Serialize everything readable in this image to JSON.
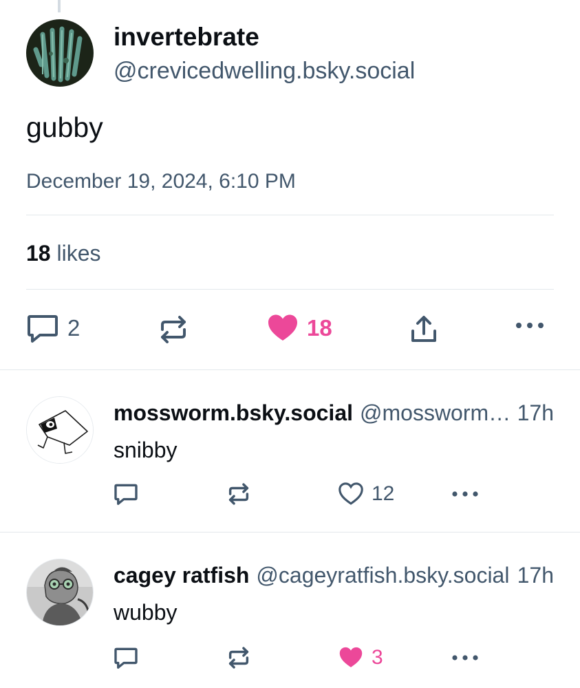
{
  "main_post": {
    "author_name": "invertebrate",
    "author_handle": "@crevicedwelling.bsky.social",
    "text": "gubby",
    "timestamp": "December 19, 2024, 6:10 PM",
    "likes_count": "18",
    "likes_label": "likes",
    "actions": {
      "reply_count": "2",
      "like_count": "18",
      "liked": true
    }
  },
  "replies": [
    {
      "author_name": "mossworm.bsky.social",
      "author_handle": "@mossworm.bsky.social",
      "time": "17h",
      "text": "snibby",
      "like_count": "12",
      "liked": false
    },
    {
      "author_name": "cagey ratfish",
      "author_handle": "@cageyratfish.bsky.social",
      "time": "17h",
      "text": "wubby",
      "like_count": "3",
      "liked": true
    }
  ],
  "icons": {
    "reply": "comment-icon",
    "repost": "repost-icon",
    "like": "heart-icon",
    "share": "share-icon",
    "more": "more-icon"
  },
  "colors": {
    "like_accent": "#ec4899",
    "muted_text": "#42576c",
    "primary_text": "#0b0f14",
    "divider": "#e3e8ec"
  }
}
